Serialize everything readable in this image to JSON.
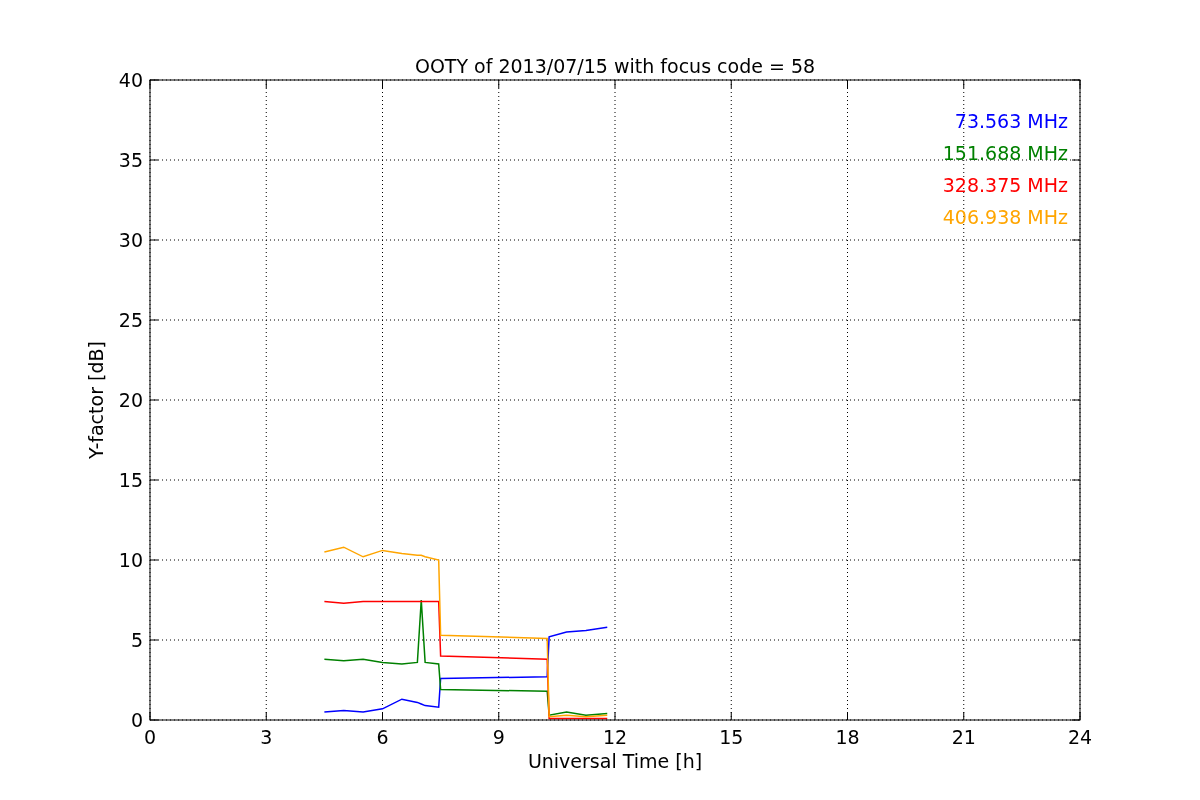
{
  "chart_data": {
    "type": "line",
    "title": "OOTY of 2013/07/15 with focus code = 58",
    "xlabel": "Universal Time [h]",
    "ylabel": "Y-factor [dB]",
    "x": [
      4.5,
      5,
      5.5,
      6,
      6.5,
      6.9,
      7,
      7.1,
      7.45,
      7.5,
      10.25,
      10.3,
      10.75,
      11.25,
      11.8
    ],
    "series": [
      {
        "name": "73.563 MHz",
        "color": "#0000ff",
        "values": [
          0.5,
          0.6,
          0.5,
          0.7,
          1.3,
          1.1,
          1.0,
          0.9,
          0.8,
          2.6,
          2.7,
          5.2,
          5.5,
          5.6,
          5.8
        ]
      },
      {
        "name": "151.688 MHz",
        "color": "#008000",
        "values": [
          3.8,
          3.7,
          3.8,
          3.6,
          3.5,
          3.6,
          7.5,
          3.6,
          3.5,
          1.9,
          1.8,
          0.3,
          0.5,
          0.3,
          0.4
        ]
      },
      {
        "name": "328.375 MHz",
        "color": "#ff0000",
        "values": [
          7.4,
          7.3,
          7.4,
          7.4,
          7.4,
          7.4,
          7.4,
          7.4,
          7.4,
          4.0,
          3.8,
          0.1,
          0.1,
          0.1,
          0.1
        ]
      },
      {
        "name": "406.938 MHz",
        "color": "#ffa500",
        "values": [
          10.5,
          10.8,
          10.2,
          10.6,
          10.4,
          10.3,
          10.3,
          10.2,
          10.0,
          5.3,
          5.1,
          0.2,
          0.3,
          0.2,
          0.3
        ]
      }
    ],
    "grid": true,
    "xlim": [
      0,
      24
    ],
    "ylim": [
      0,
      40
    ],
    "xticks": [
      0,
      3,
      6,
      9,
      12,
      15,
      18,
      21,
      24
    ],
    "yticks": [
      0,
      5,
      10,
      15,
      20,
      25,
      30,
      35,
      40
    ]
  }
}
